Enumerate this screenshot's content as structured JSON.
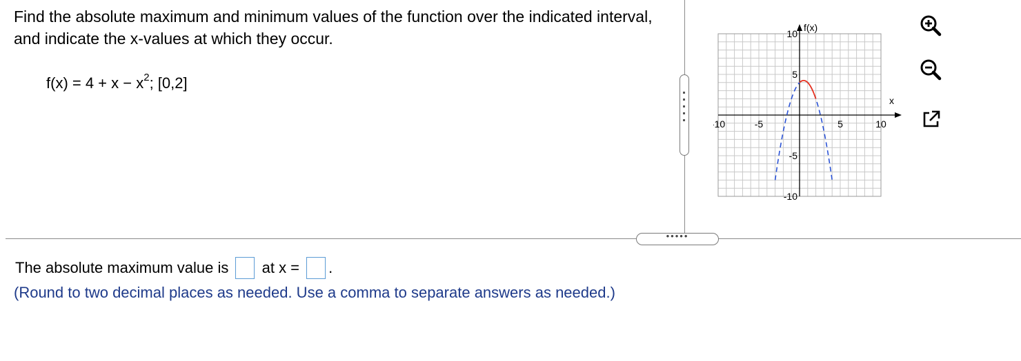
{
  "question": {
    "prompt": "Find the absolute maximum and minimum values of the function over the indicated interval, and indicate the x-values at which they occur.",
    "function_lhs": "f(x) = 4 + x − x",
    "function_exponent": "2",
    "function_interval": "; [0,2]"
  },
  "graph": {
    "y_axis_label": "f(x)",
    "x_axis_label": "x",
    "x_ticks": [
      "-10",
      "-5",
      "5",
      "10"
    ],
    "y_ticks": [
      "10",
      "5",
      "-5",
      "-10"
    ],
    "xlim": [
      -10,
      10
    ],
    "ylim": [
      -10,
      10
    ],
    "curve_function": "4 + x - x^2",
    "highlight_interval": [
      0,
      2
    ],
    "colors": {
      "grid": "#c8c8c8",
      "dashed_curve": "#2a52d6",
      "interval_curve": "#e8321e"
    }
  },
  "toolbar": {
    "zoom_in_icon": "zoom-in-icon",
    "zoom_out_icon": "zoom-out-icon",
    "popout_icon": "popout-icon"
  },
  "splitter": {
    "handle_dots": "•••••"
  },
  "answer": {
    "prefix": "The absolute maximum value is",
    "middle": "at x =",
    "suffix": ".",
    "max_value": "",
    "x_value": "",
    "note": "(Round to two decimal places as needed. Use a comma to separate answers as needed.)"
  }
}
